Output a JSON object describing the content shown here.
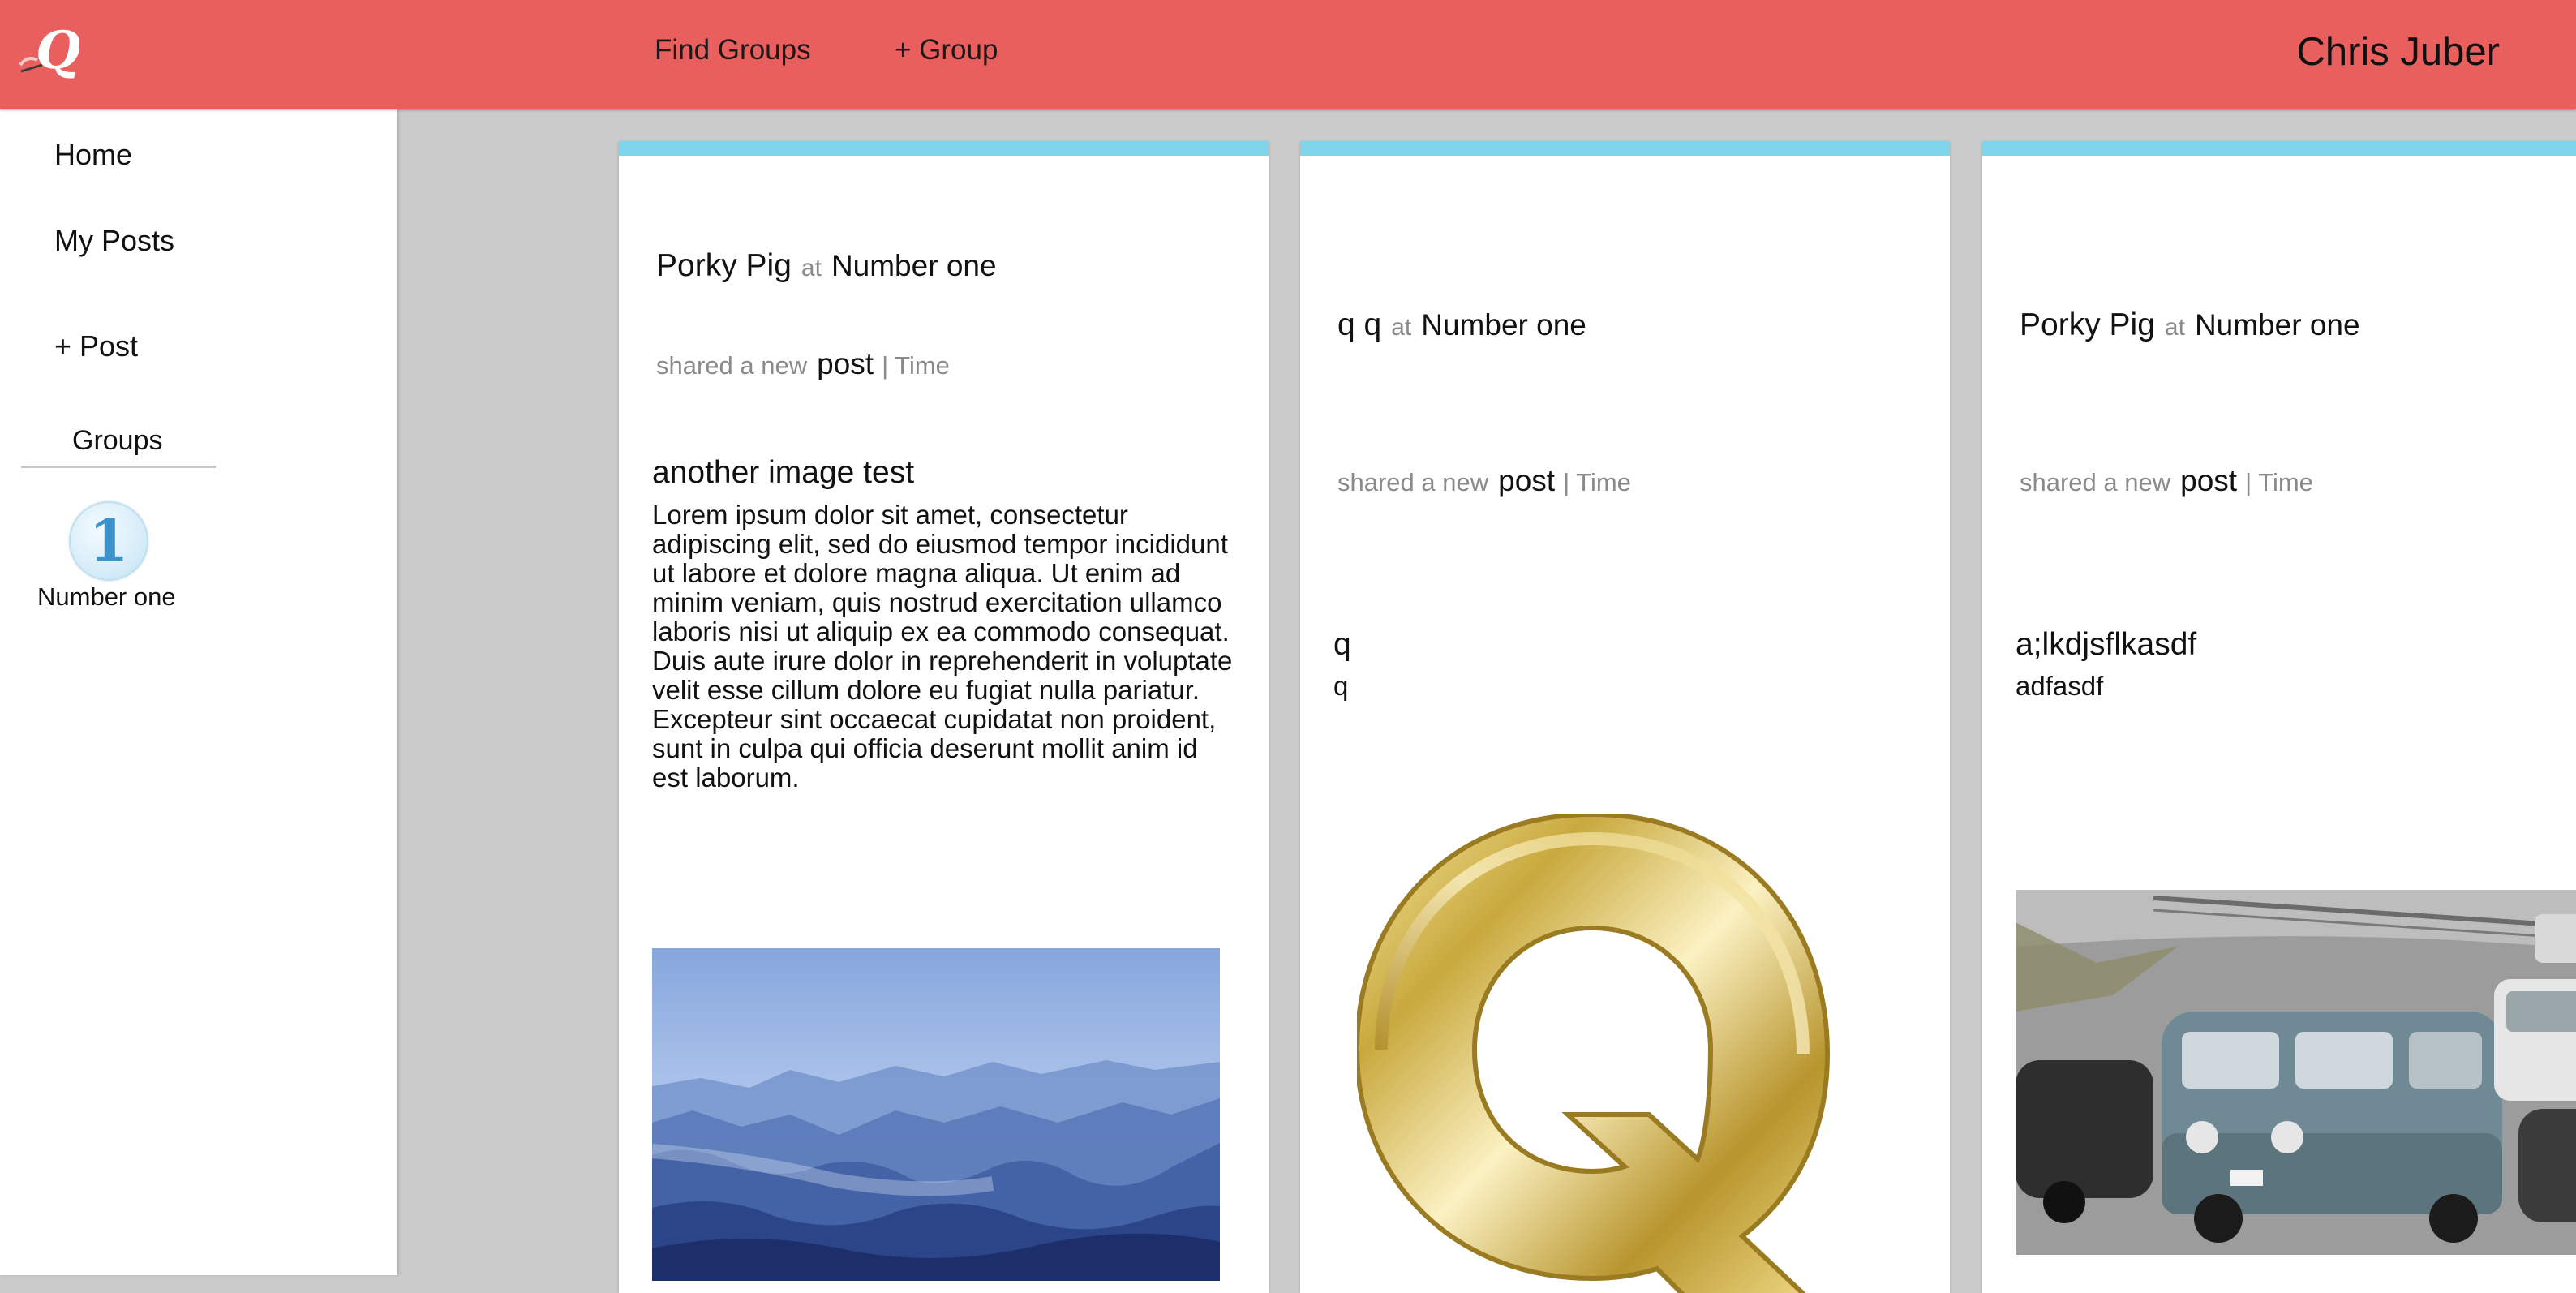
{
  "header": {
    "logo_letter": "Q",
    "nav": {
      "find_groups": "Find Groups",
      "add_group": "+ Group"
    },
    "user_name": "Chris Juber"
  },
  "sidebar": {
    "items": [
      {
        "label": "Home"
      },
      {
        "label": "My Posts"
      },
      {
        "label": "+ Post"
      }
    ],
    "groups_heading": "Groups",
    "groups": [
      {
        "badge": "1",
        "name": "Number one"
      }
    ]
  },
  "cards": [
    {
      "author": "Porky Pig",
      "at": "at",
      "group": "Number one",
      "shared": "shared a new",
      "post_word": "post",
      "time": "| Time",
      "title": "another image test",
      "body": "Lorem ipsum dolor sit amet, consectetur adipiscing elit, sed do eiusmod tempor incididunt ut labore et dolore magna aliqua. Ut enim ad minim veniam, quis nostrud exercitation ullamco laboris nisi ut aliquip ex ea commodo consequat. Duis aute irure dolor in reprehenderit in voluptate velit esse cillum dolore eu fugiat nulla pariatur. Excepteur sint occaecat cupidatat non proident, sunt in culpa qui officia deserunt mollit anim id est laborum.",
      "image": "misty-mountains-image"
    },
    {
      "author": "q q",
      "at": "at",
      "group": "Number one",
      "shared": "shared a new",
      "post_word": "post",
      "time": "| Time",
      "title": "q",
      "body": "q",
      "image": "gold-letter-q-image"
    },
    {
      "author": "Porky Pig",
      "at": "at",
      "group": "Number one",
      "shared": "shared a new",
      "post_word": "post",
      "time": "| Time",
      "title": "a;lkdjsflkasdf",
      "body": "adfasdf",
      "image": "street-traffic-vw-bus-image"
    }
  ],
  "colors": {
    "header_bg": "#e85f5d",
    "card_accent": "#7fd5ea",
    "page_bg": "#cbcbcb",
    "muted_text": "#8a8a8a",
    "badge_blue": "#3c93cc"
  }
}
